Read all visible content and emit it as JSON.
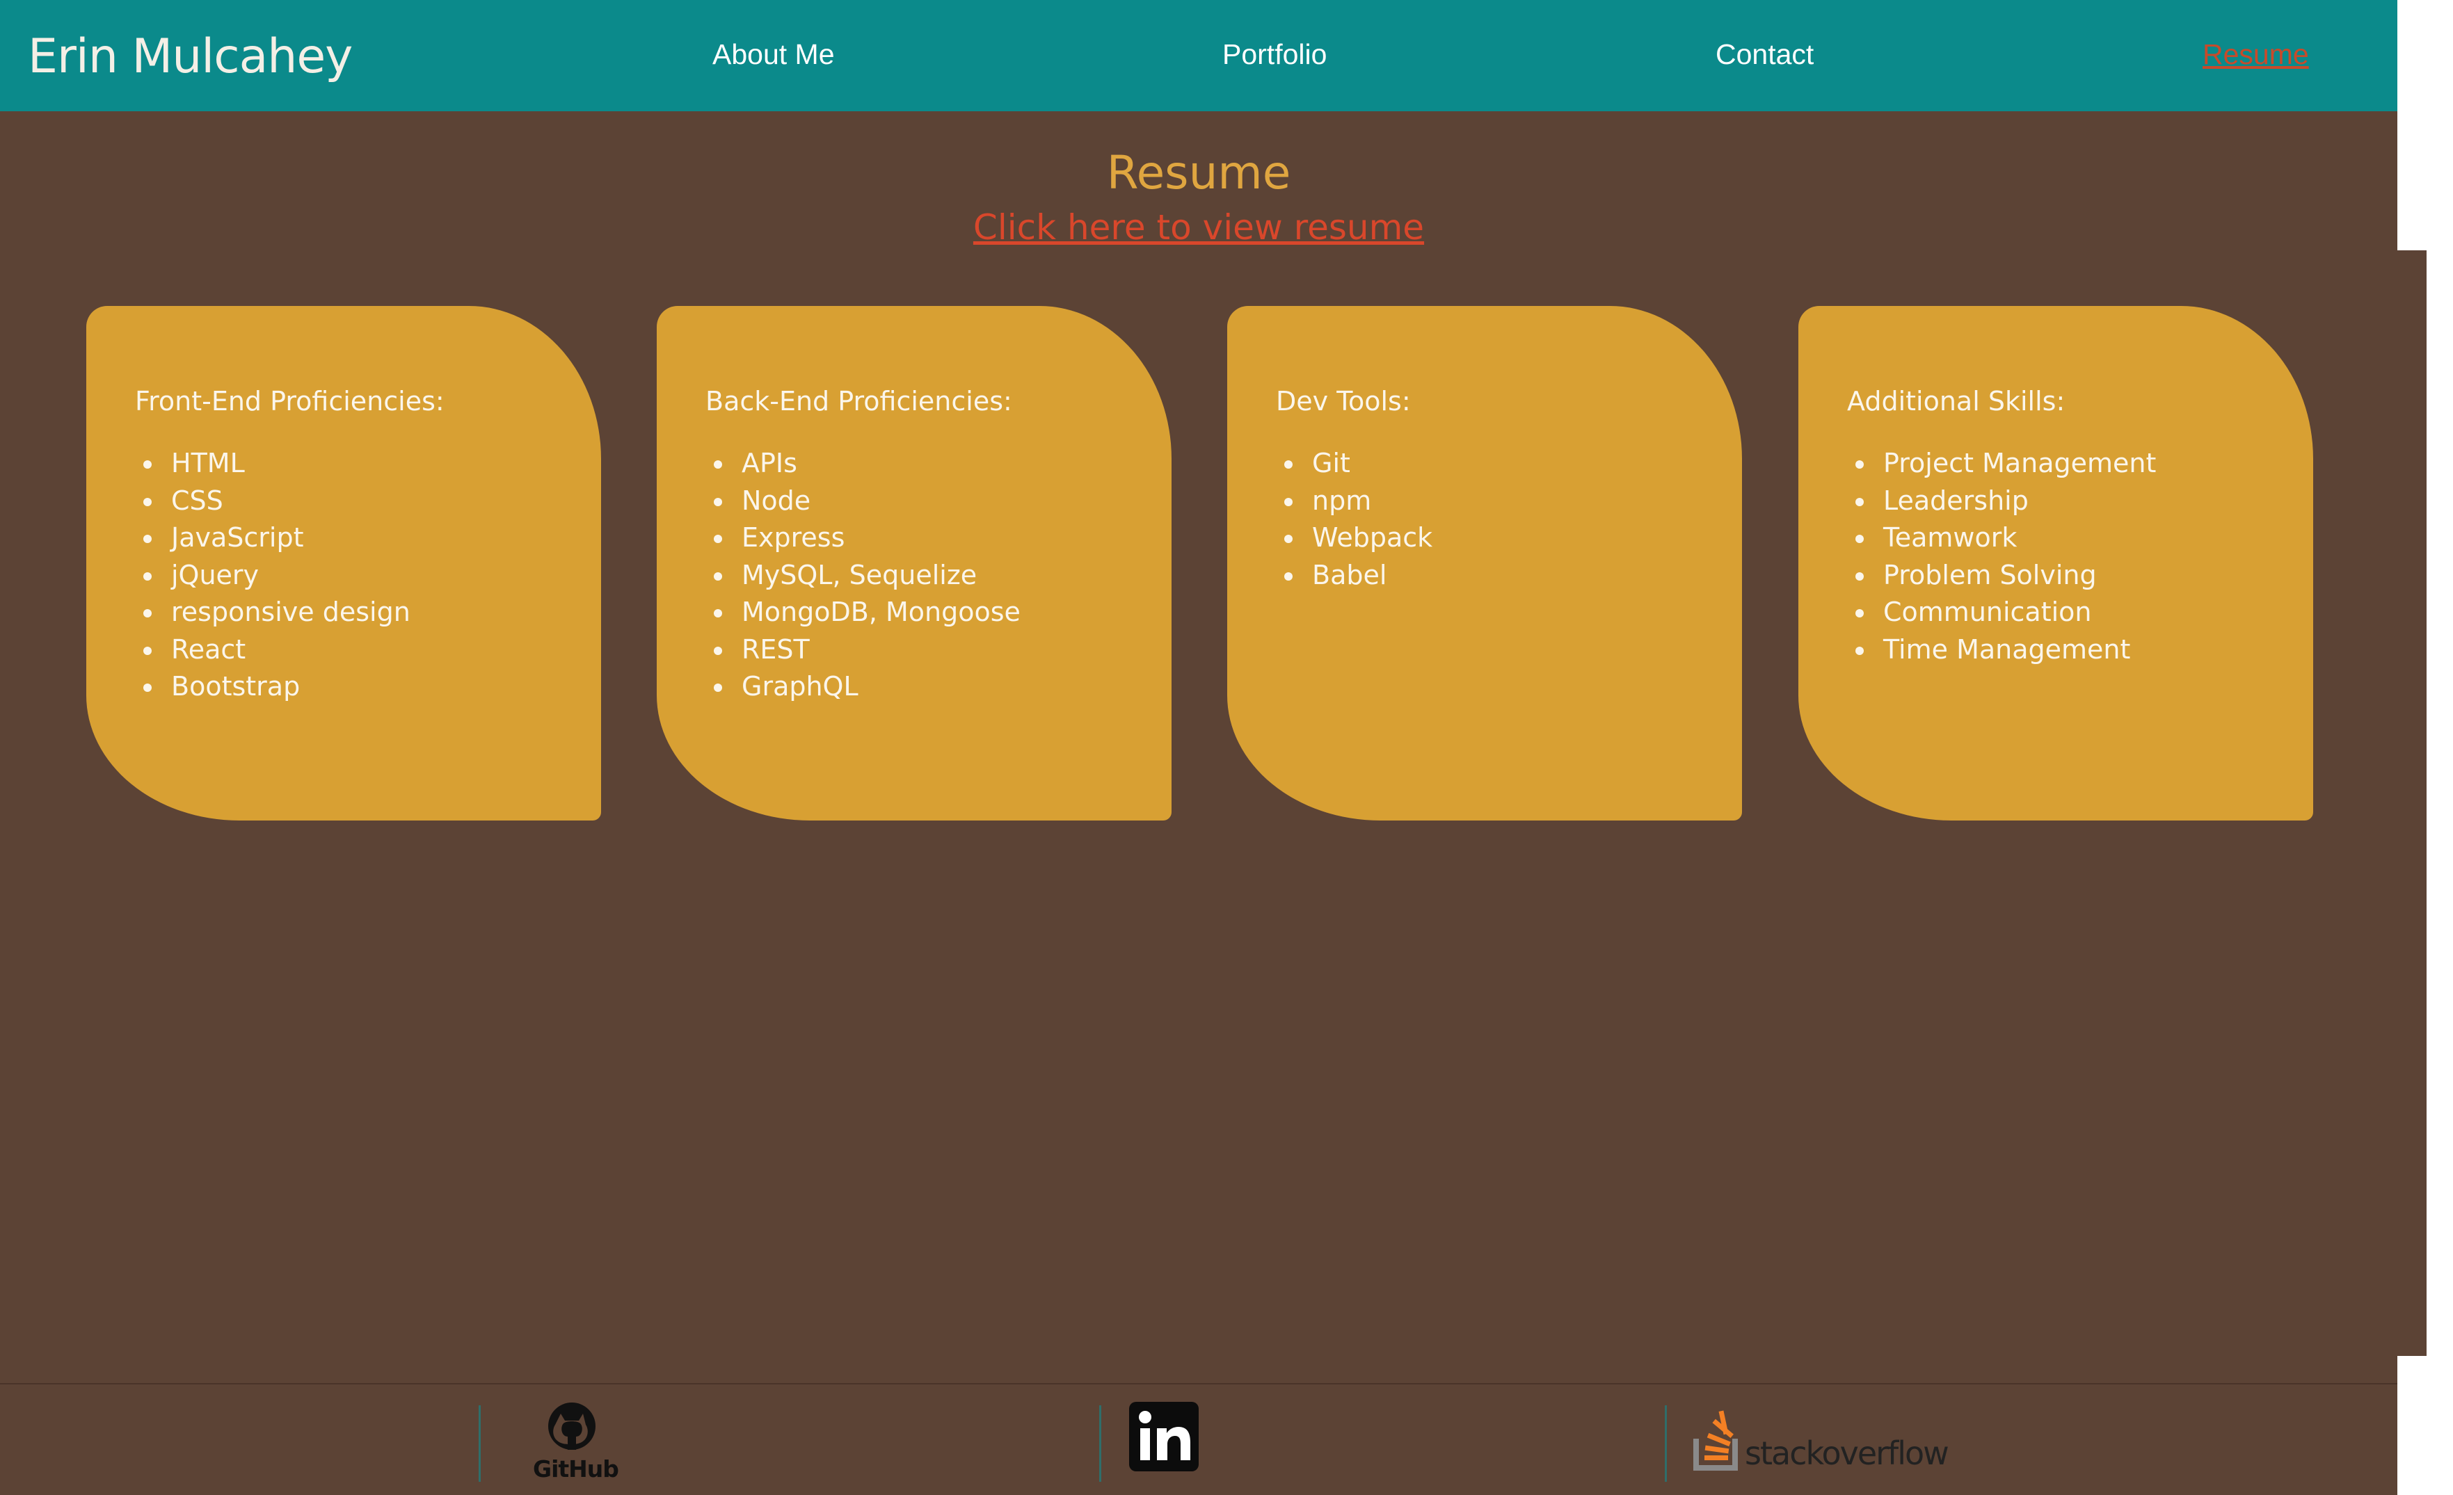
{
  "header": {
    "brand": "Erin Mulcahey",
    "nav": [
      {
        "label": "About Me",
        "active": false
      },
      {
        "label": "Portfolio",
        "active": false
      },
      {
        "label": "Contact",
        "active": false
      },
      {
        "label": "Resume",
        "active": true
      }
    ]
  },
  "main": {
    "title": "Resume",
    "resume_link": "Click here to view resume",
    "cards": [
      {
        "title": "Front-End Proficiencies:",
        "items": [
          "HTML",
          "CSS",
          "JavaScript",
          "jQuery",
          "responsive design",
          "React",
          "Bootstrap"
        ]
      },
      {
        "title": "Back-End Proficiencies:",
        "items": [
          "APIs",
          "Node",
          "Express",
          "MySQL, Sequelize",
          "MongoDB, Mongoose",
          "REST",
          "GraphQL"
        ]
      },
      {
        "title": "Dev Tools:",
        "items": [
          "Git",
          "npm",
          "Webpack",
          "Babel"
        ]
      },
      {
        "title": "Additional Skills:",
        "items": [
          "Project Management",
          "Leadership",
          "Teamwork",
          "Problem Solving",
          "Communication",
          "Time Management"
        ]
      }
    ]
  },
  "footer": {
    "links": [
      {
        "name": "GitHub",
        "icon": "github-icon"
      },
      {
        "name": "linkedin-icon",
        "icon": "linkedin-icon"
      },
      {
        "name": "stackoverflow",
        "icon": "stackoverflow-icon"
      }
    ]
  },
  "colors": {
    "nav_bg": "#0b8a8b",
    "page_bg": "#5c4335",
    "card_bg": "#d8a033",
    "accent_link": "#d9472b",
    "title": "#e0a640"
  }
}
